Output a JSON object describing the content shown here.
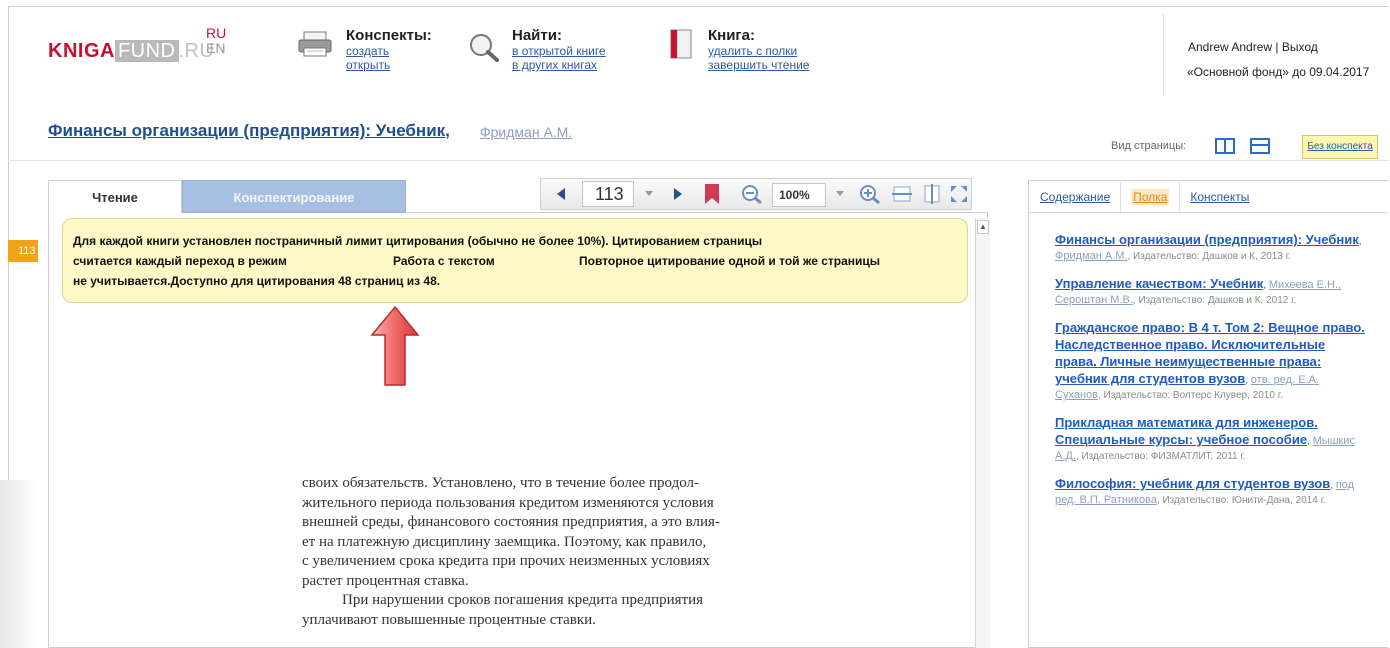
{
  "header": {
    "logo": {
      "part1": "KNIGA",
      "part2": "FUND",
      "part3": ".RU"
    },
    "lang": {
      "ru": "RU",
      "en": "EN"
    },
    "notes": {
      "title": "Конспекты:",
      "create": "создать",
      "open": "открыть"
    },
    "find": {
      "title": "Найти:",
      "in_open": "в открытой книге",
      "in_other": "в других книгах"
    },
    "book": {
      "title": "Книга:",
      "remove": "удалить с полки",
      "finish": "завершить чтение"
    },
    "user": {
      "name": "Andrew Andrew",
      "separator": " | ",
      "logout": "Выход"
    },
    "fund": "«Основной фонд» до 09.04.2017"
  },
  "book_title": "Финансы организации (предприятия): Учебник",
  "book_comma": ",",
  "book_author": "Фридман А.М.",
  "view": {
    "label": "Вид страницы:",
    "no_notes": "Без конспекта"
  },
  "tabs": {
    "reading": "Чтение",
    "notes": "Конспектирование"
  },
  "toolbar": {
    "page": "113",
    "zoom": "100%"
  },
  "page_badge": "113",
  "tooltip": {
    "line1": "Для каждой книги установлен постраничный лимит цитирования (обычно не более 10%). Цитированием страницы",
    "line2a": "считается каждый переход в режим",
    "line2b": "Работа с текстом",
    "line2c": "Повторное цитирование одной и той же страницы",
    "line3": "не учитывается.Доступно для цитирования 48 страниц из 48."
  },
  "page_text": {
    "l1": "своих обязательств. Установлено, что в течение более продол-",
    "l2": "жительного периода пользования кредитом изменяются условия",
    "l3": "внешней среды, финансового состояния предприятия, а это влия-",
    "l4": "ет на платежную дисциплину заемщика. Поэтому, как правило,",
    "l5": "с увеличением срока кредита при прочих неизменных условиях",
    "l6": "растет процентная ставка.",
    "l7": "При нарушении сроков погашения кредита предприятия",
    "l8": "уплачивают повышенные процентные ставки."
  },
  "right_tabs": {
    "contents": "Содержание",
    "shelf": "Полка",
    "notes": "Конспекты"
  },
  "shelf": [
    {
      "title": "Финансы организации (предприятия): Учебник",
      "author": "Фридман А.М.",
      "pub": ", Издательство: Дашков и К, 2013 г."
    },
    {
      "title": "Управление качеством: Учебник",
      "author": "Михеева Е.Н., Сероштан М.В.",
      "pub": ", Издательство: Дашков и К, 2012 г."
    },
    {
      "title": "Гражданское право: В 4 т. Том 2: Вещное право. Наследственное право. Исключительные права. Личные неимущественные права: учебник для студентов вузов",
      "author": "отв. ред. Е.А. Суханов",
      "pub": ", Издательство: Волтерс Клувер, 2010 г."
    },
    {
      "title": "Прикладная математика для инженеров. Специальные курсы: учебное пособие",
      "author": "Мышкис А.Д.",
      "pub": ", Издательство: ФИЗМАТЛИТ, 2011 г."
    },
    {
      "title": "Философия: учебник для студентов вузов",
      "author": "под ред. В.П. Ратникова",
      "pub": ", Издательство: Юнити-Дана, 2014 г."
    }
  ],
  "colors": {
    "accent": "#c8102e",
    "link": "#2a5aa8",
    "tooltip_bg": "#fff8c7",
    "badge": "#f0a21a",
    "bookmark": "#d23b55"
  },
  "icons": [
    "printer-icon",
    "magnifier-icon",
    "book-icon",
    "arrow-left-icon",
    "arrow-right-icon",
    "bookmark-icon",
    "zoom-out-icon",
    "zoom-in-icon",
    "fit-width-icon",
    "fit-height-icon",
    "fullscreen-icon",
    "two-page-icon",
    "single-page-icon",
    "red-arrow-up-icon"
  ]
}
